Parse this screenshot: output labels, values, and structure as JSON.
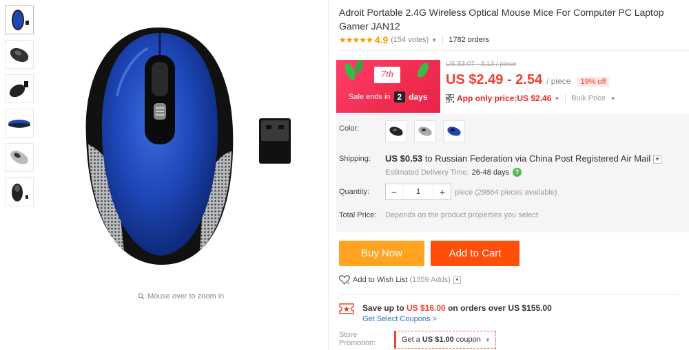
{
  "gallery": {
    "thumbnails": [
      "blue-mouse-thumb",
      "black-mouse-thumb",
      "black-mouse-receiver-thumb",
      "blue-mouse-side-thumb",
      "silver-mouse-thumb",
      "black-mouse-top-thumb"
    ],
    "zoom_hint": "Mouse over to zoom in"
  },
  "product": {
    "title": "Adroit Portable 2.4G Wireless Optical Mouse Mice For Computer PC Laptop Gamer JAN12",
    "stars": "★★★★★",
    "rating": "4.9",
    "votes": "(154 votes)",
    "orders": "1782 orders"
  },
  "promo": {
    "badge": "7th",
    "sale_ends_label": "Sale ends in",
    "days_num": "2",
    "days_word": "days",
    "original_price": "US $3.07 - 3.13 / piece",
    "current_price": "US $2.49 - 2.54",
    "per_piece": "/ piece",
    "discount": "19% off",
    "app_price": "App only price:US $2.46",
    "bulk_price": "Bulk Price"
  },
  "properties": {
    "color_label": "Color:",
    "colors": [
      "black",
      "silver",
      "blue"
    ],
    "shipping_label": "Shipping:",
    "shipping_cost": "US $0.53",
    "shipping_rest": " to Russian Federation via China Post Registered Air Mail",
    "delivery_label": "Estimated Delivery Time:",
    "delivery_days": "26-48 days",
    "quantity_label": "Quantity:",
    "quantity_value": "1",
    "quantity_avail": "piece (29864 pieces available)",
    "total_label": "Total Price:",
    "total_value": "Depends on the product properties you select"
  },
  "actions": {
    "buy_now": "Buy Now",
    "add_to_cart": "Add to Cart",
    "wish_list": "Add to Wish List",
    "wish_count": "(1359 Adds)"
  },
  "coupons": {
    "save_prefix": "Save up to ",
    "save_amount": "US $16.00",
    "save_suffix": " on orders over US $155.00",
    "get_coupons": "Get Select Coupons >",
    "store_label_1": "Store",
    "store_label_2": "Promotion:",
    "store_coupon_prefix": "Get a",
    "store_coupon_amount": "US $1.00",
    "store_coupon_suffix": "coupon"
  },
  "colors": {
    "price_red": "#f03e2e",
    "buy_now_bg": "#ffa321",
    "add_cart_bg": "#ff4e0a",
    "star_orange": "#ff9500",
    "mouse_blue": "#1e47b8"
  }
}
